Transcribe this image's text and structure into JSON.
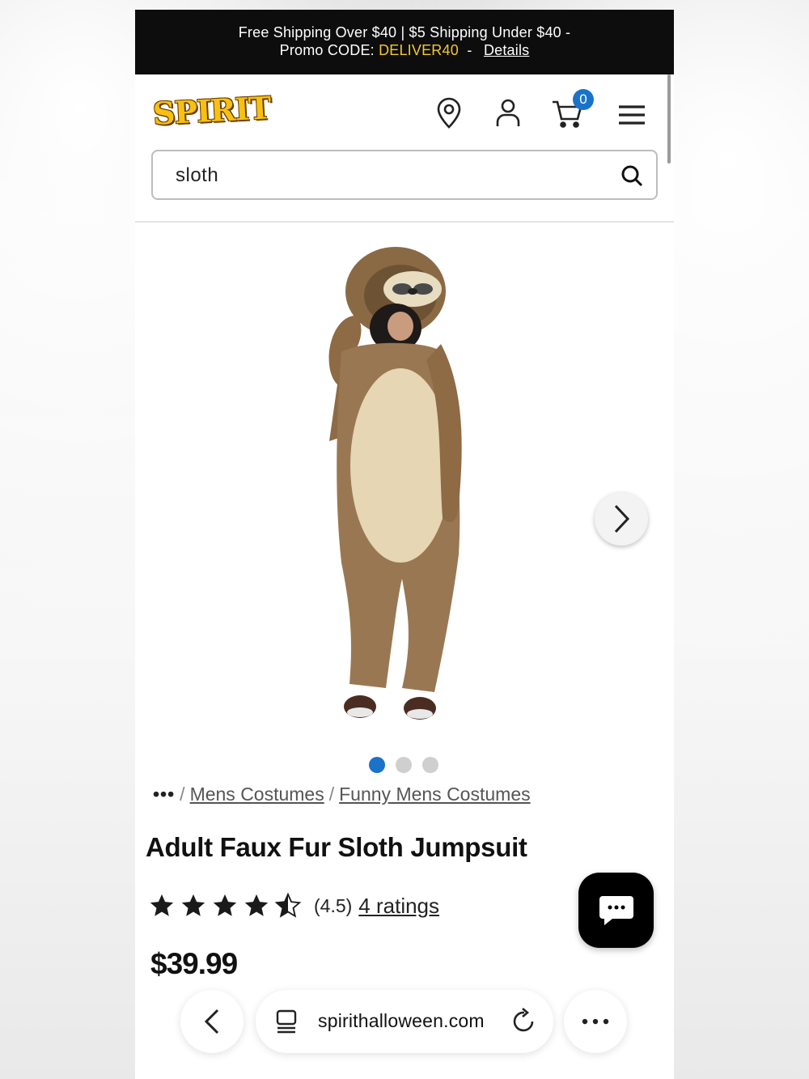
{
  "promo": {
    "line1": "Free Shipping Over $40 | $5 Shipping Under $40 -",
    "line2_prefix": "Promo CODE:",
    "code": "DELIVER40",
    "separator": "-",
    "details_link": "Details"
  },
  "header": {
    "logo_text": "SPIRIT",
    "cart_count": "0",
    "icons": [
      "location-pin-icon",
      "account-icon",
      "cart-icon",
      "hamburger-menu-icon"
    ]
  },
  "search": {
    "value": "sloth",
    "icon": "search-icon"
  },
  "gallery": {
    "image_count": 3,
    "active_index": 0
  },
  "breadcrumb": {
    "more": "•••",
    "sep": "/",
    "items": [
      "Mens Costumes",
      "Funny Mens Costumes"
    ]
  },
  "product": {
    "title": "Adult Faux Fur Sloth Jumpsuit",
    "rating_value": 4.5,
    "rating_text": "(4.5)",
    "ratings_link": "4 ratings",
    "price": "$39.99"
  },
  "browser": {
    "url": "spirithalloween.com"
  },
  "colors": {
    "promo_bg": "#0d0d0d",
    "promo_code": "#f3c82a",
    "accent_blue": "#1a73c8"
  }
}
